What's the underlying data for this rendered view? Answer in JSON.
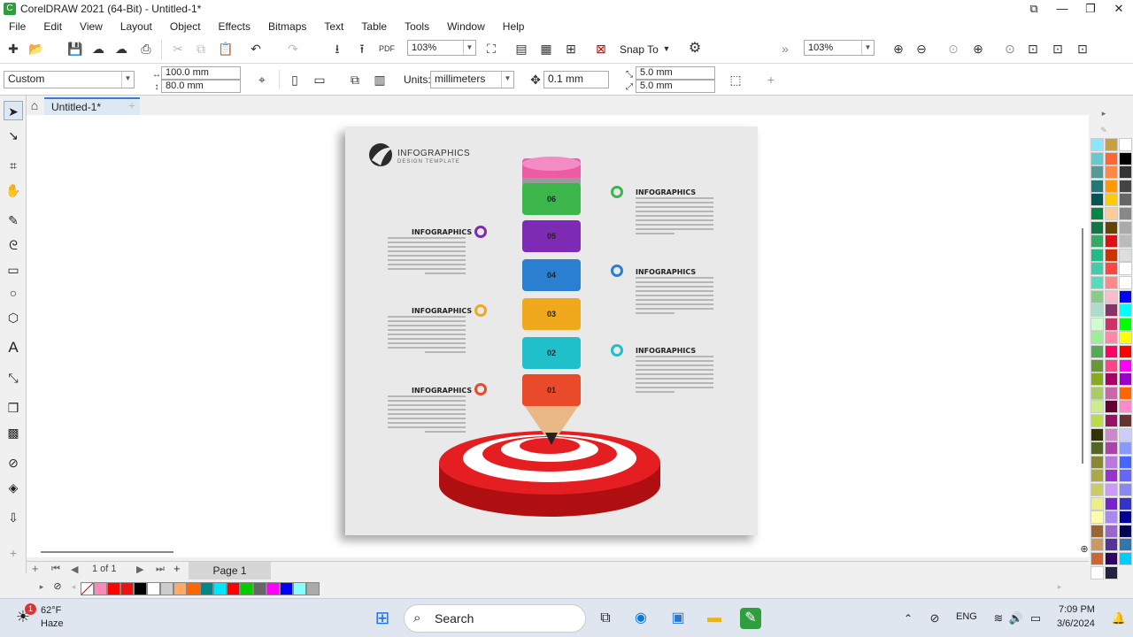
{
  "window": {
    "title": "CorelDRAW 2021 (64-Bit) - Untitled-1*",
    "icons": [
      "restore-icon",
      "minimize-icon",
      "maximize-icon",
      "close-icon"
    ]
  },
  "menu": [
    "File",
    "Edit",
    "View",
    "Layout",
    "Object",
    "Effects",
    "Bitmaps",
    "Text",
    "Table",
    "Tools",
    "Window",
    "Help"
  ],
  "toolbar1": {
    "zoom_left": "103%",
    "snap_to": "Snap To",
    "zoom_right": "103%"
  },
  "toolbar2": {
    "preset": "Custom",
    "width": "100.0 mm",
    "height": "80.0 mm",
    "units_label": "Units:",
    "units_value": "millimeters",
    "nudge": "0.1 mm",
    "dup_x": "5.0 mm",
    "dup_y": "5.0 mm"
  },
  "document_tab": "Untitled-1*",
  "artwork": {
    "logo_title": "INFOGRAPHICS",
    "logo_sub": "DESIGN TEMPLATE",
    "heading": "INFOGRAPHICS",
    "segments": [
      "06",
      "05",
      "04",
      "03",
      "02",
      "01"
    ],
    "segment_colors": [
      "#3cb54a",
      "#7d2bb5",
      "#2a7fd0",
      "#f0a81c",
      "#1fc0c9",
      "#e84a2a"
    ]
  },
  "pagebar": {
    "page_count": "1 of 1",
    "page_tab": "Page 1"
  },
  "taskbar": {
    "weather_temp": "62°F",
    "weather_desc": "Haze",
    "search": "Search",
    "lang": "ENG",
    "time": "7:09 PM",
    "date": "3/6/2024",
    "notif": "1"
  },
  "palette_bottom": [
    "#ffffff",
    "#ff88bb",
    "#ff0000",
    "#ee1111",
    "#000000",
    "#ffffff",
    "#cccccc",
    "#ffaa66",
    "#ff6600",
    "#008888",
    "#00e5ff",
    "#ff0000",
    "#00cc00",
    "#666666",
    "#ff00ff",
    "#0000ff",
    "#88ffff",
    "#aaaaaa"
  ],
  "palette_right": [
    "#88e8ff",
    "#c8a040",
    "#ffffff",
    "#66c8d0",
    "#ff6633",
    "#000000",
    "#559999",
    "#ff8844",
    "#333333",
    "#227777",
    "#ff9900",
    "#444444",
    "#005555",
    "#ffcc00",
    "#666666",
    "#008844",
    "#ffcc99",
    "#888888",
    "#117744",
    "#664400",
    "#aaaaaa",
    "#33aa66",
    "#dd1111",
    "#bbbbbb",
    "#22bb88",
    "#cc3300",
    "#dddddd",
    "#44ccaa",
    "#ff4444",
    "#ffffff",
    "#55ddbb",
    "#ff8888",
    "#ffffff",
    "#88cc88",
    "#ffbbcc",
    "#0000ff",
    "#aaddcc",
    "#883366",
    "#00ffff",
    "#ccffcc",
    "#cc3366",
    "#00ff00",
    "#99ee99",
    "#ff88aa",
    "#ffff00",
    "#55aa55",
    "#ff0066",
    "#ff0000",
    "#669933",
    "#ff4488",
    "#ff00ff",
    "#88aa22",
    "#aa0066",
    "#9900cc",
    "#aacc66",
    "#cc66aa",
    "#ff6600",
    "#ccee88",
    "#660033",
    "#ff88cc",
    "#bbdd44",
    "#991166",
    "#663333",
    "#333300",
    "#cc88cc",
    "#ccccff",
    "#556622",
    "#aa44aa",
    "#8899ff",
    "#888833",
    "#bb77dd",
    "#4466ff",
    "#aaaa44",
    "#9933cc",
    "#6666ff",
    "#cccc66",
    "#cc99ff",
    "#8888ee",
    "#eeee88",
    "#7722cc",
    "#3333cc",
    "#ffffaa",
    "#aa88ee",
    "#000099",
    "#996633",
    "#9966cc",
    "#000055",
    "#cc9966",
    "#553399",
    "#3377aa",
    "#cc6633",
    "#330066",
    "#00ccff",
    "#ffffff",
    "#222244"
  ]
}
